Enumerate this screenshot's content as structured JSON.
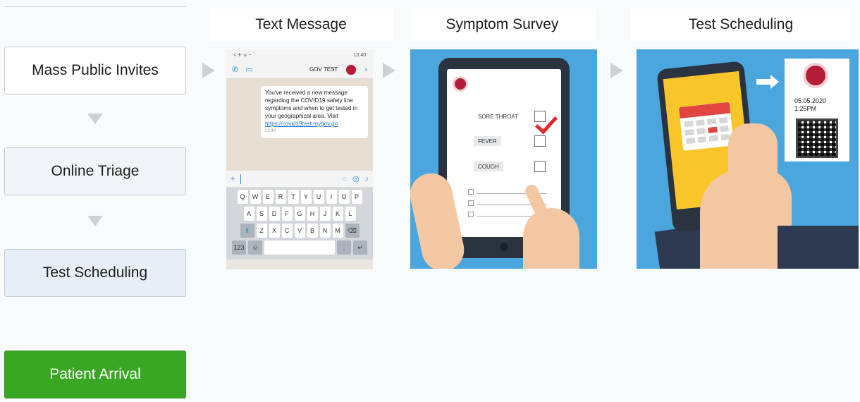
{
  "steps": [
    {
      "label": "Mass Public Invites"
    },
    {
      "label": "Online Triage"
    },
    {
      "label": "Test Scheduling"
    },
    {
      "label": "Patient Arrival"
    }
  ],
  "columns": {
    "text_message": "Text Message",
    "symptom_survey": "Symptom Survey",
    "test_scheduling": "Test Scheduling"
  },
  "phone": {
    "status_left": "< ✈ ᯤ ⁃",
    "status_time": "13:40",
    "contact": "GOV TEST",
    "message": "You've received a new message regarding the COVID19 safety line symptoms and when to get tested in your geographical area. Visit",
    "link": "https://covid19test.mygov.gn",
    "message_time": "13:40",
    "keyboard_rows": [
      [
        "Q",
        "W",
        "E",
        "R",
        "T",
        "Y",
        "U",
        "I",
        "O",
        "P"
      ],
      [
        "A",
        "S",
        "D",
        "F",
        "G",
        "H",
        "J",
        "K",
        "L"
      ],
      [
        "Z",
        "X",
        "C",
        "V",
        "B",
        "N",
        "M"
      ]
    ],
    "key_123": "123"
  },
  "survey": {
    "rows": [
      "SORE THROAT",
      "FEVER",
      "COUGH"
    ]
  },
  "appointment": {
    "date": "05.05.2020",
    "time": "1:25PM"
  },
  "colors": {
    "arrival_green": "#3aa724",
    "illustration_blue": "#4aa6dd",
    "logo_red": "#b41c37"
  }
}
